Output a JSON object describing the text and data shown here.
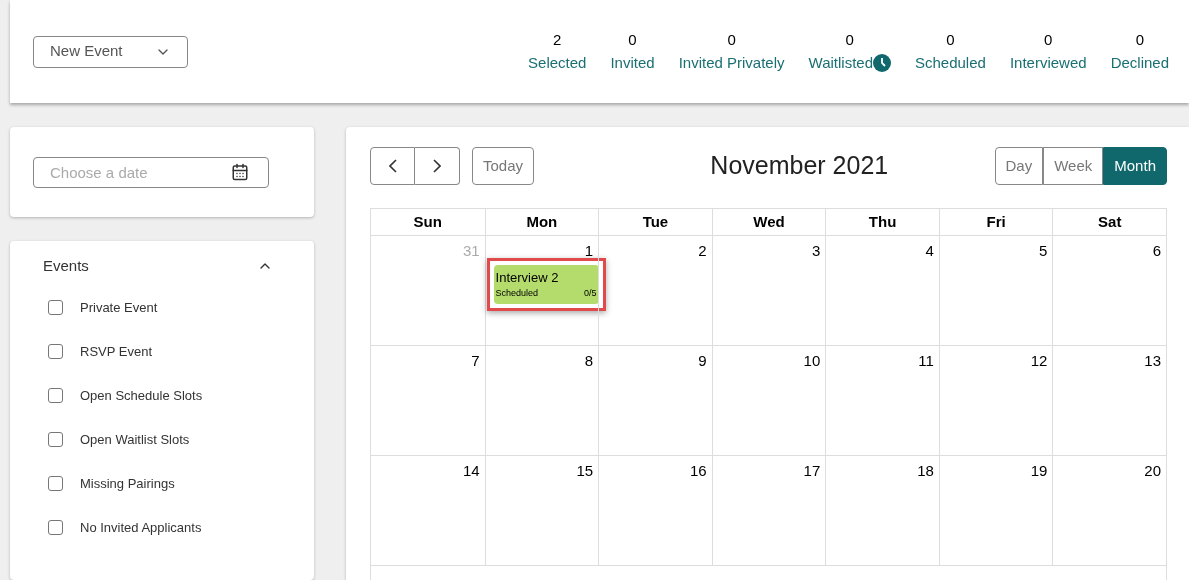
{
  "header": {
    "new_event": {
      "label": "New Event"
    },
    "stats": [
      {
        "count": "2",
        "label": "Selected",
        "kind": "plain"
      },
      {
        "count": "0",
        "label": "Invited",
        "kind": "plain"
      },
      {
        "count": "0",
        "label": "Invited Privately",
        "kind": "plain"
      },
      {
        "count": "0",
        "label": "Waitlisted",
        "kind": "clock"
      },
      {
        "count": "0",
        "label": "Scheduled",
        "kind": "plain"
      },
      {
        "count": "0",
        "label": "Interviewed",
        "kind": "plain"
      },
      {
        "count": "0",
        "label": "Declined",
        "kind": "plain"
      }
    ]
  },
  "date_picker": {
    "placeholder": "Choose a date"
  },
  "events_filter": {
    "title": "Events",
    "expanded": true,
    "items": [
      {
        "label": "Private Event",
        "checked": false
      },
      {
        "label": "RSVP Event",
        "checked": false
      },
      {
        "label": "Open Schedule Slots",
        "checked": false
      },
      {
        "label": "Open Waitlist Slots",
        "checked": false
      },
      {
        "label": "Missing Pairings",
        "checked": false
      },
      {
        "label": "No Invited Applicants",
        "checked": false
      }
    ]
  },
  "calendar": {
    "today": "Today",
    "title": "November 2021",
    "views": [
      {
        "label": "Day",
        "selected": false
      },
      {
        "label": "Week",
        "selected": false
      },
      {
        "label": "Month",
        "selected": true
      }
    ],
    "weekdays": [
      "Sun",
      "Mon",
      "Tue",
      "Wed",
      "Thu",
      "Fri",
      "Sat"
    ],
    "weeks": [
      [
        {
          "day": "31",
          "other_month": true
        },
        {
          "day": "1",
          "other_month": false,
          "events": [
            {
              "title": "Interview 2",
              "status": "Scheduled",
              "count": "0/5",
              "color": "#b3dc6c",
              "highlighted": true
            }
          ]
        },
        {
          "day": "2",
          "other_month": false
        },
        {
          "day": "3",
          "other_month": false
        },
        {
          "day": "4",
          "other_month": false
        },
        {
          "day": "5",
          "other_month": false
        },
        {
          "day": "6",
          "other_month": false
        }
      ],
      [
        {
          "day": "7",
          "other_month": false
        },
        {
          "day": "8",
          "other_month": false
        },
        {
          "day": "9",
          "other_month": false
        },
        {
          "day": "10",
          "other_month": false
        },
        {
          "day": "11",
          "other_month": false
        },
        {
          "day": "12",
          "other_month": false
        },
        {
          "day": "13",
          "other_month": false
        }
      ],
      [
        {
          "day": "14",
          "other_month": false
        },
        {
          "day": "15",
          "other_month": false
        },
        {
          "day": "16",
          "other_month": false
        },
        {
          "day": "17",
          "other_month": false
        },
        {
          "day": "18",
          "other_month": false
        },
        {
          "day": "19",
          "other_month": false
        },
        {
          "day": "20",
          "other_month": false
        }
      ]
    ]
  }
}
